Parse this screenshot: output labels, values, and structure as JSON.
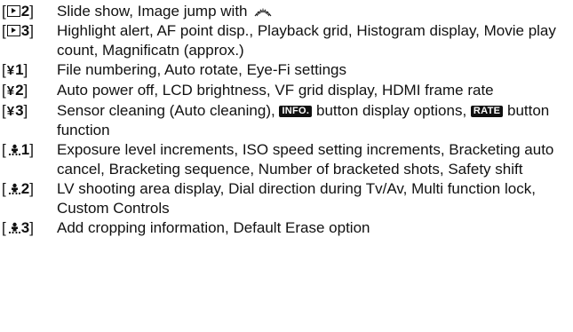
{
  "items": [
    {
      "tag_pre": "[",
      "tag_num": "2",
      "tag_post": "]",
      "text": "Slide show, Image jump with"
    },
    {
      "tag_pre": "[",
      "tag_num": "3",
      "tag_post": "]",
      "text": "Highlight alert, AF point disp., Playback grid, Histogram display, Movie play count, Magnificatn (approx.)"
    },
    {
      "tag_pre": "[",
      "tag_num": "1",
      "tag_post": "]",
      "text": "File numbering, Auto rotate, Eye-Fi settings"
    },
    {
      "tag_pre": "[",
      "tag_num": "2",
      "tag_post": "]",
      "text": "Auto power off, LCD brightness, VF grid display, HDMI frame rate"
    },
    {
      "tag_pre": "[",
      "tag_num": "3",
      "tag_post": "]",
      "text_a": "Sensor cleaning (Auto cleaning),",
      "badge_a": "INFO.",
      "text_b": "button display options,",
      "badge_b": "RATE",
      "text_c": "button function"
    },
    {
      "tag_pre": "[",
      "tag_num": "1",
      "tag_post": "]",
      "text": "Exposure level increments, ISO speed setting increments, Bracketing auto cancel, Bracketing sequence, Number of bracketed shots, Safety shift"
    },
    {
      "tag_pre": "[",
      "tag_num": "2",
      "tag_post": "]",
      "text": "LV shooting area display, Dial direction during Tv/Av, Multi function lock, Custom Controls"
    },
    {
      "tag_pre": "[",
      "tag_num": "3",
      "tag_post": "]",
      "text": "Add cropping information, Default Erase option"
    }
  ],
  "icons": {
    "playback": "playback-icon",
    "setup": "wrench-icon",
    "custom": "custom-functions-icon",
    "dial": "main-dial-icon"
  },
  "glyphs": {
    "wrench": "¥"
  }
}
